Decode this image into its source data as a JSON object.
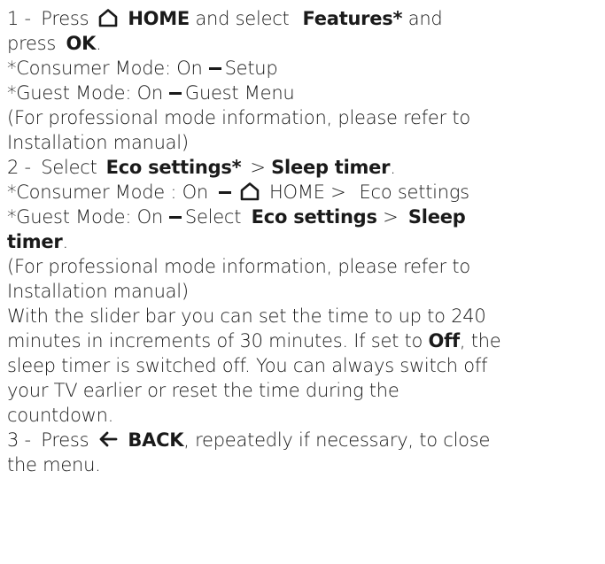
{
  "step1": {
    "num": "1 - ",
    "press": "Press",
    "home": "HOME",
    "and_select": "and select",
    "features": "Features*",
    "and": "and",
    "press2": "press",
    "ok": "OK",
    "period": "."
  },
  "note1": {
    "consumer_prefix": "*Consumer Mode: On",
    "consumer_target": "Setup",
    "guest_prefix": "*Guest Mode: On",
    "guest_target": "Guest Menu",
    "professional_1": "(For professional mode information, please refer to",
    "professional_2": "Installation manual)"
  },
  "step2": {
    "num": "2 - ",
    "select": "Select",
    "eco": "Eco settings*",
    "gt": "> ",
    "sleep": "Sleep timer",
    "period": "."
  },
  "note2": {
    "consumer_prefix": "*Consumer Mode : On",
    "home": "HOME",
    "gt": ">",
    "eco": "Eco settings",
    "guest_prefix": "*Guest Mode: On",
    "select": "Select",
    "eco2": "Eco settings",
    "gt2": ">",
    "sleep": "Sleep",
    "timer": "timer",
    "period": ".",
    "professional_1": "(For professional mode information, please refer to",
    "professional_2": "Installation manual)"
  },
  "body": {
    "l1": "With the slider bar you can set the time to up to 240",
    "l2a": "minutes in increments of 30 minutes. If set to ",
    "off": "Off",
    "l2b": ", the",
    "l3": "sleep timer is switched off. You can always switch off",
    "l4": "your TV earlier or reset the time during the",
    "l5": "countdown."
  },
  "step3": {
    "num": "3 - ",
    "press": "Press",
    "back": "BACK",
    "rest": ", repeatedly if necessary, to close",
    "rest2": "the menu."
  },
  "icons": {
    "home": "home-icon",
    "back": "back-arrow-icon",
    "dash": "dash-icon"
  },
  "colors": {
    "text": "#1a1a1a",
    "background": "#ffffff"
  }
}
